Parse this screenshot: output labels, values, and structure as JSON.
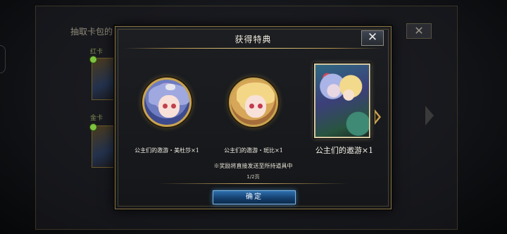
{
  "background": {
    "header": "抽取卡包的",
    "labels": [
      "红卡",
      "金卡"
    ],
    "close_symbol": "✕"
  },
  "dialog": {
    "title": "获得特典",
    "close_symbol": "✕",
    "rewards": [
      {
        "label": "公主们的邀游・美杜莎×1",
        "icon": "portrait-medal"
      },
      {
        "label": "公主们的邀游・斑比×1",
        "icon": "portrait-medal"
      },
      {
        "label": "公主们的邀游×1",
        "icon": "card-art"
      }
    ],
    "notice": "※奖励将直接发送至所持道具中",
    "page": "1/2页",
    "confirm_label": "确定"
  },
  "colors": {
    "accent_gold": "#c9a451",
    "confirm_blue": "#2d6fae"
  }
}
